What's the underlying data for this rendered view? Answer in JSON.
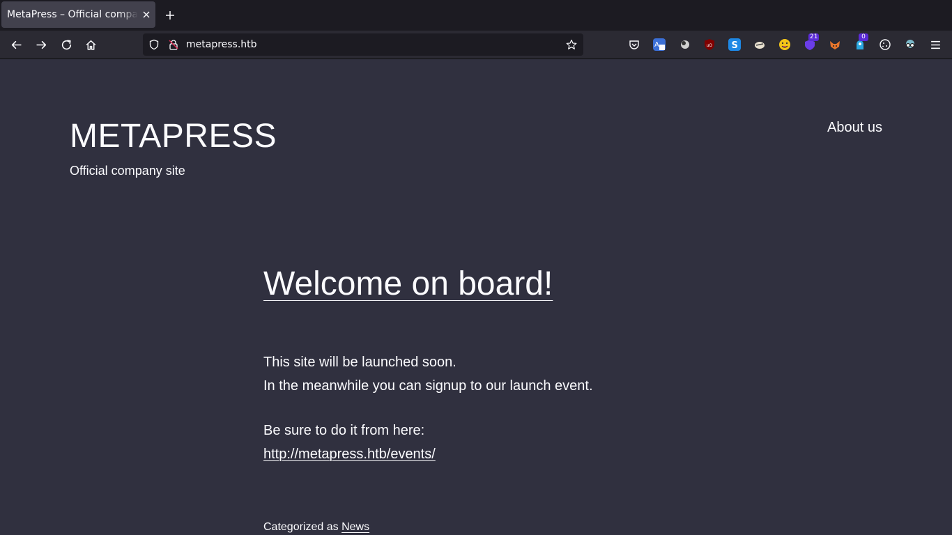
{
  "browser": {
    "tab_title": "MetaPress – Official company site",
    "url": "metapress.htb",
    "icons": {
      "back": "back-arrow-icon",
      "forward": "forward-arrow-icon",
      "reload": "reload-icon",
      "home": "home-icon",
      "tracking": "shield-icon",
      "insecure": "insecure-lock-icon",
      "bookmark": "star-icon",
      "menu": "hamburger-menu-icon"
    },
    "extensions": [
      {
        "name": "pocket-icon"
      },
      {
        "name": "translate-icon"
      },
      {
        "name": "extension-ball-icon"
      },
      {
        "name": "ublock-origin-icon"
      },
      {
        "name": "extension-s-icon"
      },
      {
        "name": "extension-bug-icon"
      },
      {
        "name": "extension-face-icon"
      },
      {
        "name": "extension-shield-icon",
        "badge": "21"
      },
      {
        "name": "extension-fox-icon"
      },
      {
        "name": "extension-blue-icon",
        "badge": "0"
      },
      {
        "name": "cookie-icon"
      },
      {
        "name": "extension-glasses-icon"
      }
    ]
  },
  "site": {
    "title": "METAPRESS",
    "tagline": "Official company site",
    "nav": [
      {
        "label": "About us"
      }
    ]
  },
  "post": {
    "title": "Welcome on board!",
    "lines": [
      "This site will be launched soon.",
      "In the meanwhile you can signup to our launch event.",
      "Be sure to do it from here:"
    ],
    "link": "http://metapress.htb/events/",
    "category_prefix": "Categorized as",
    "category": "News"
  },
  "colors": {
    "page_background": "#30303f",
    "text": "#fbfbfe",
    "chrome_dark": "#1c1b22",
    "chrome_mid": "#2b2a33",
    "tab_active": "#42414d"
  }
}
